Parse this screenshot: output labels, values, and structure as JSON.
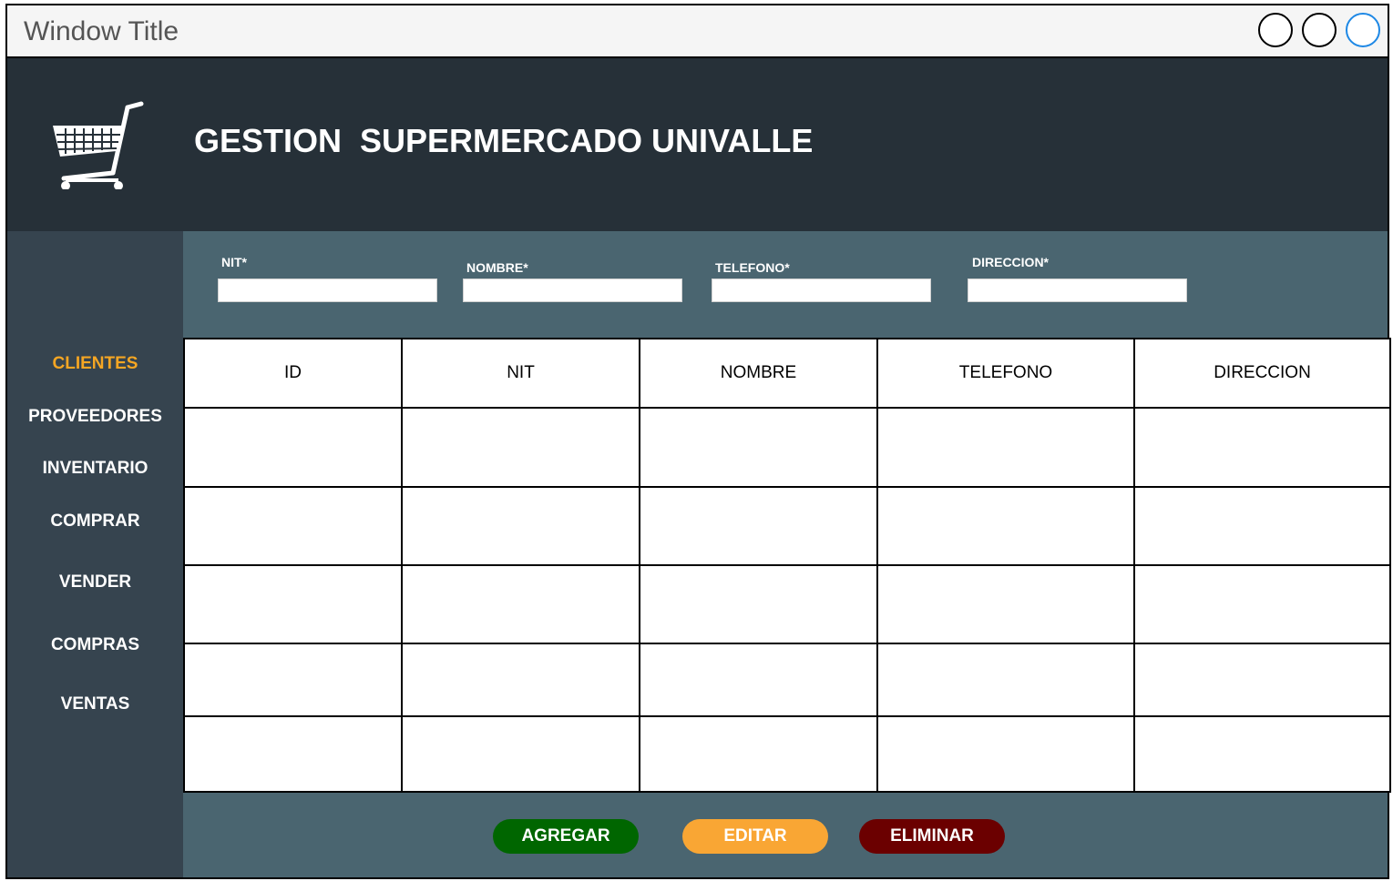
{
  "window": {
    "title": "Window Title"
  },
  "header": {
    "app_title": "GESTION  SUPERMERCADO UNIVALLE",
    "logo_icon": "shopping-cart-icon"
  },
  "sidebar": {
    "active_color": "#f5a623",
    "items": [
      {
        "label": "CLIENTES",
        "active": true
      },
      {
        "label": "PROVEEDORES"
      },
      {
        "label": "INVENTARIO"
      },
      {
        "label": "COMPRAR"
      },
      {
        "label": "VENDER"
      },
      {
        "label": "COMPRAS"
      },
      {
        "label": "VENTAS"
      }
    ]
  },
  "form": {
    "fields": [
      {
        "label": "NIT*",
        "value": ""
      },
      {
        "label": "NOMBRE*",
        "value": ""
      },
      {
        "label": "TELEFONO*",
        "value": ""
      },
      {
        "label": "DIRECCION*",
        "value": ""
      }
    ]
  },
  "table": {
    "columns": [
      "ID",
      "NIT",
      "NOMBRE",
      "TELEFONO",
      "DIRECCION"
    ],
    "rows": [
      [
        "",
        "",
        "",
        "",
        ""
      ],
      [
        "",
        "",
        "",
        "",
        ""
      ],
      [
        "",
        "",
        "",
        "",
        ""
      ],
      [
        "",
        "",
        "",
        "",
        ""
      ],
      [
        "",
        "",
        "",
        "",
        ""
      ]
    ]
  },
  "actions": {
    "add": {
      "label": "AGREGAR",
      "color": "#006600"
    },
    "edit": {
      "label": "EDITAR",
      "color": "#f9a634"
    },
    "delete": {
      "label": "ELIMINAR",
      "color": "#6b0000"
    }
  }
}
